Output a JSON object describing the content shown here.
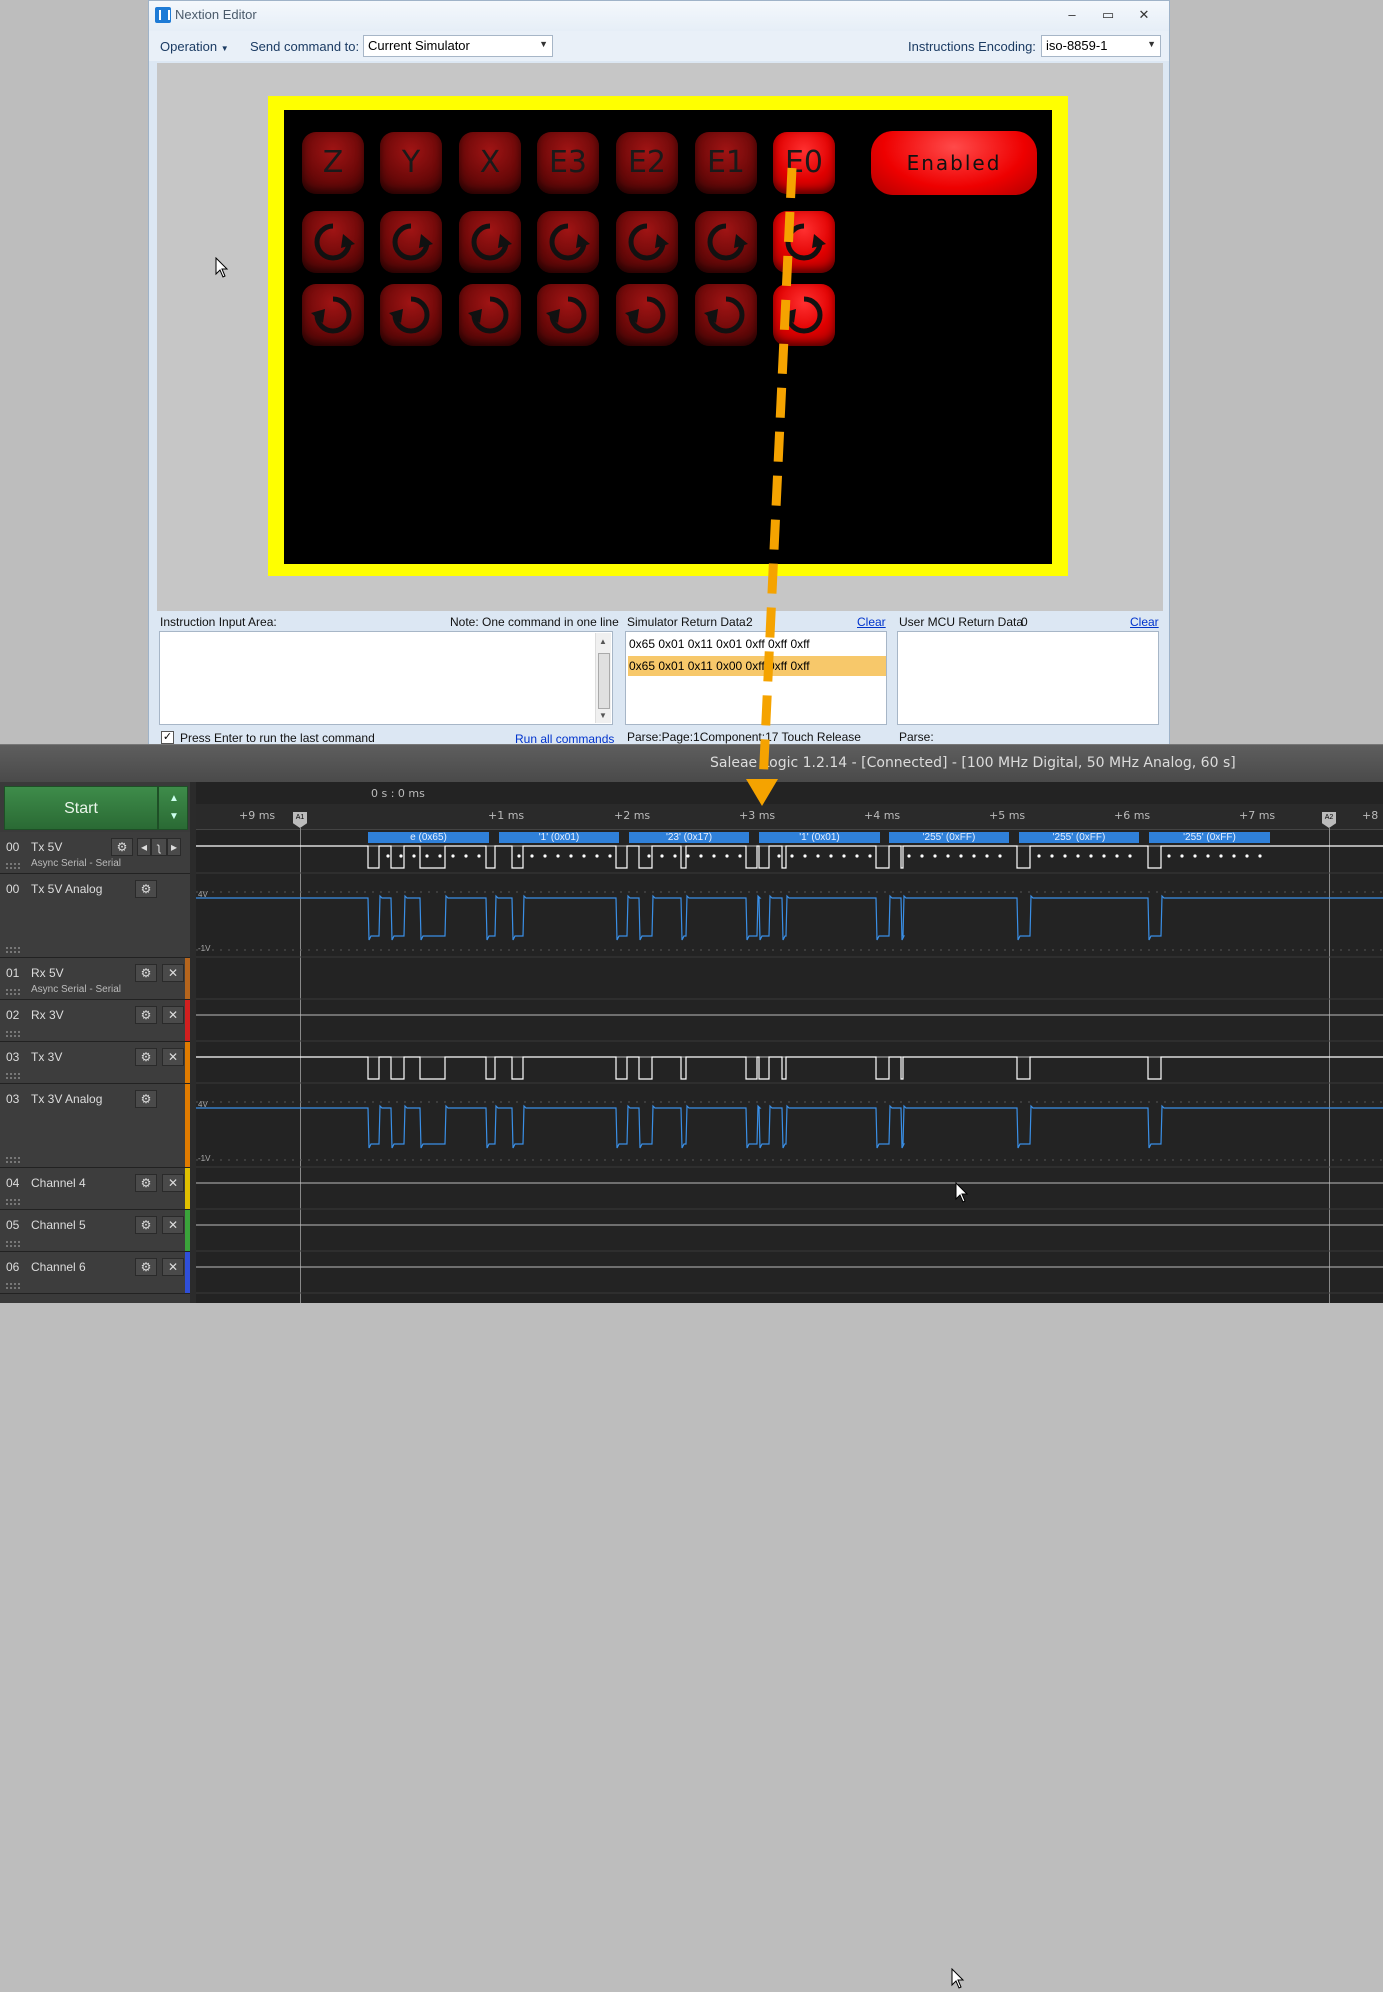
{
  "nextion": {
    "title": "Nextion Editor",
    "win_buttons": {
      "min": "–",
      "max": "▭",
      "close": "✕"
    },
    "menu": {
      "operation": "Operation",
      "send_label": "Send command to:",
      "send_value": "Current Simulator",
      "enc_label": "Instructions Encoding:",
      "enc_value": "iso-8859-1"
    },
    "row1_labels": [
      "Z",
      "Y",
      "X",
      "E3",
      "E2",
      "E1",
      "E0"
    ],
    "enabled_label": "Enabled",
    "input_area": {
      "label": "Instruction Input Area:",
      "note": "Note: One command in one line",
      "checkbox_label": "Press Enter to run the last command",
      "run_all": "Run all commands"
    },
    "sim_return": {
      "label": "Simulator Return Data:",
      "count": "2",
      "clear": "Clear",
      "rows": [
        "0x65 0x01 0x11 0x01 0xff 0xff 0xff",
        "0x65 0x01 0x11 0x00 0xff 0xff 0xff"
      ],
      "parse": "Parse:Page:1Component:17 Touch Release"
    },
    "mcu_return": {
      "label": "User MCU Return Data",
      "count": "0",
      "clear": "Clear",
      "parse": "Parse:"
    }
  },
  "saleae": {
    "title": "Saleae Logic 1.2.14 - [Connected] - [100 MHz Digital, 50 MHz Analog, 60 s]",
    "start_label": "Start",
    "time_origin": "0 s : 0 ms",
    "ticks": [
      "+9 ms",
      "+1 ms",
      "+2 ms",
      "+3 ms",
      "+4 ms",
      "+5 ms",
      "+6 ms",
      "+7 ms",
      "+8"
    ],
    "markers": [
      "A1",
      "A2"
    ],
    "protocol_frames": [
      "e (0x65)",
      "'1' (0x01)",
      "'23' (0x17)",
      "'1' (0x01)",
      "'255' (0xFF)",
      "'255' (0xFF)",
      "'255' (0xFF)"
    ],
    "analog_labels": [
      "4V",
      "-1V"
    ],
    "channels": [
      {
        "num": "00",
        "name": "Tx 5V",
        "sub": "Async Serial - Serial",
        "color": "#777777"
      },
      {
        "num": "00",
        "name": "Tx 5V Analog",
        "sub": "",
        "color": "#777777"
      },
      {
        "num": "01",
        "name": "Rx 5V",
        "sub": "Async Serial - Serial",
        "color": "#b5651d"
      },
      {
        "num": "02",
        "name": "Rx 3V",
        "sub": "",
        "color": "#d11f1f"
      },
      {
        "num": "03",
        "name": "Tx 3V",
        "sub": "",
        "color": "#e07b00"
      },
      {
        "num": "03",
        "name": "Tx 3V Analog",
        "sub": "",
        "color": "#e07b00"
      },
      {
        "num": "04",
        "name": "Channel 4",
        "sub": "",
        "color": "#e0c000"
      },
      {
        "num": "05",
        "name": "Channel 5",
        "sub": "",
        "color": "#3aa33a"
      },
      {
        "num": "06",
        "name": "Channel 6",
        "sub": "",
        "color": "#2f4fd9"
      }
    ],
    "colors": {
      "protocol": "#2f80d9",
      "signal": "#ffffff",
      "analog": "#3a8fe6",
      "arrow": "#f5a300"
    }
  }
}
